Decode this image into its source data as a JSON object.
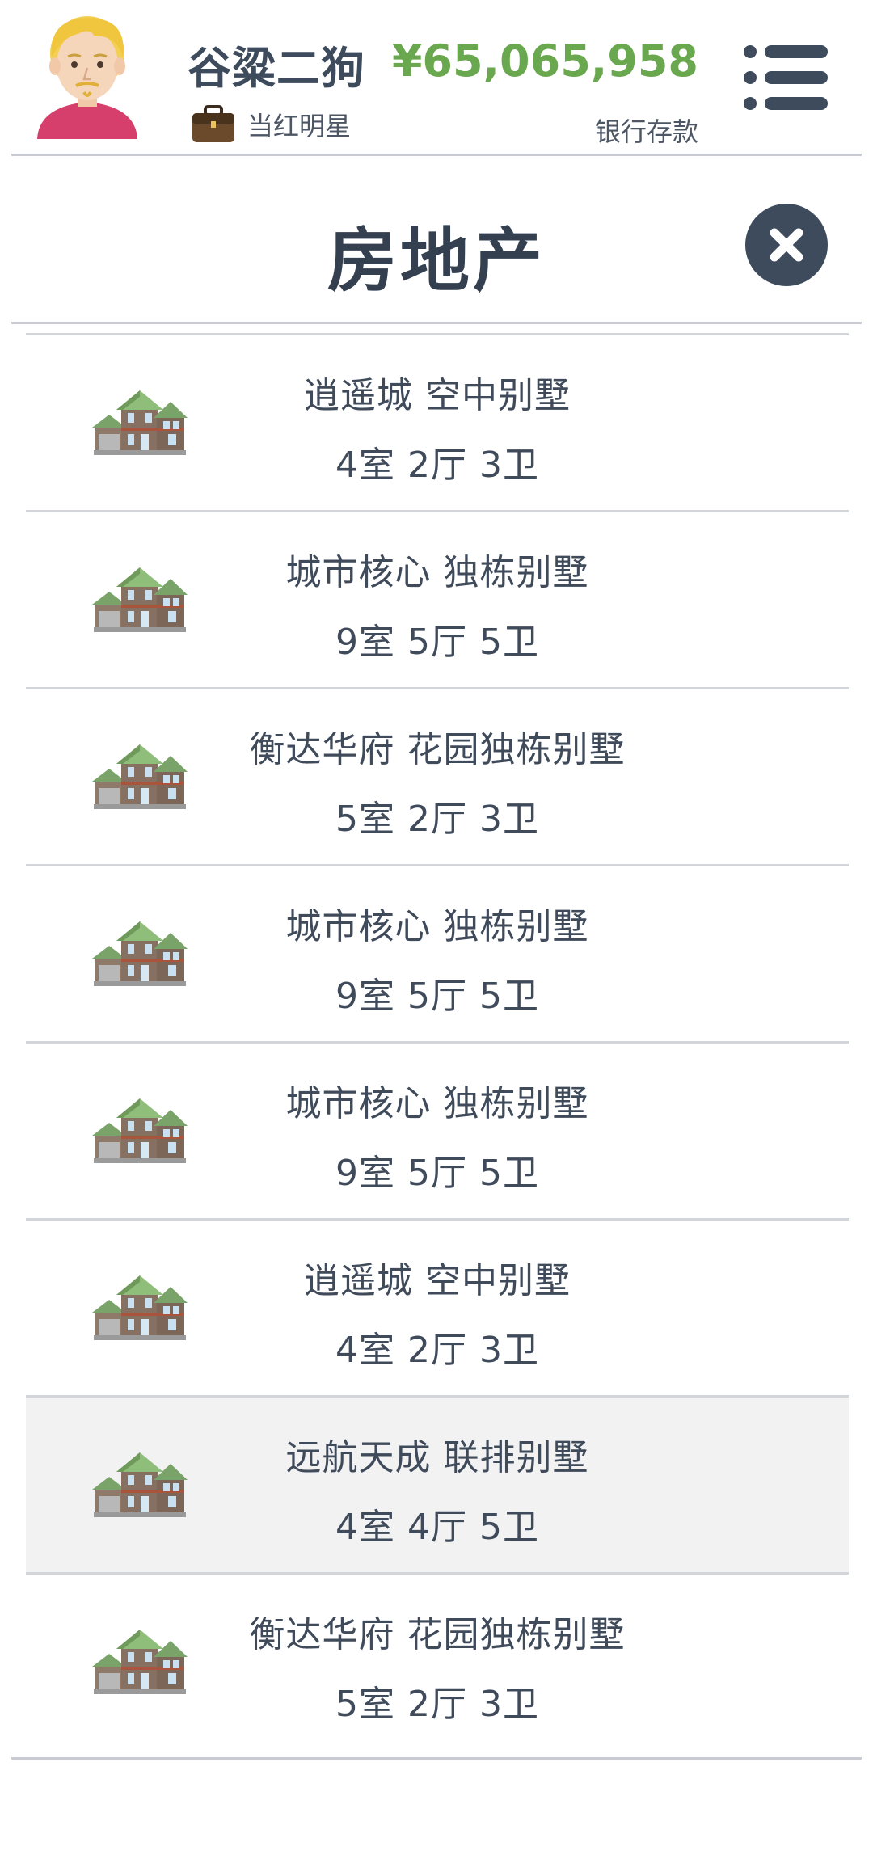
{
  "header": {
    "player_name": "谷粱二狗",
    "job_title": "当红明星",
    "money": "¥65,065,958",
    "money_label": "银行存款",
    "icons": {
      "avatar": "player-avatar",
      "job": "briefcase-icon",
      "menu": "menu-list-icon"
    }
  },
  "page": {
    "title": "房地产",
    "close_icon": "close-icon"
  },
  "properties": [
    {
      "name": "逍遥城 空中别墅",
      "spec": "4室 2厅 3卫",
      "icon": "villa-icon"
    },
    {
      "name": "城市核心 独栋别墅",
      "spec": "9室 5厅 5卫",
      "icon": "villa-icon"
    },
    {
      "name": "衡达华府 花园独栋别墅",
      "spec": "5室 2厅 3卫",
      "icon": "villa-icon"
    },
    {
      "name": "城市核心 独栋别墅",
      "spec": "9室 5厅 5卫",
      "icon": "villa-icon"
    },
    {
      "name": "城市核心 独栋别墅",
      "spec": "9室 5厅 5卫",
      "icon": "villa-icon"
    },
    {
      "name": "逍遥城 空中别墅",
      "spec": "4室 2厅 3卫",
      "icon": "villa-icon"
    },
    {
      "name": "远航天成 联排别墅",
      "spec": "4室 4厅 5卫",
      "icon": "villa-icon"
    },
    {
      "name": "衡达华府 花园独栋别墅",
      "spec": "5室 2厅 3卫",
      "icon": "villa-icon"
    }
  ],
  "colors": {
    "money_green": "#6aa84f",
    "dark_slate": "#3d4b5c",
    "highlight_row": "#f2f2f2",
    "divider": "#c8ccd2"
  }
}
